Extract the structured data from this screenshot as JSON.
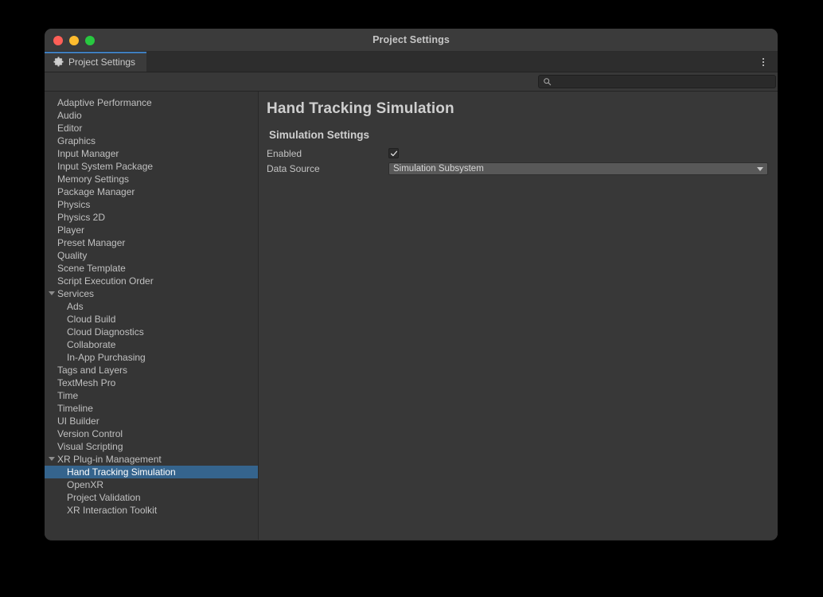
{
  "window": {
    "title": "Project Settings",
    "traffic_lights": [
      {
        "name": "close",
        "color": "#ff5f57"
      },
      {
        "name": "minimize",
        "color": "#febc2e"
      },
      {
        "name": "zoom",
        "color": "#28c840"
      }
    ]
  },
  "tab": {
    "label": "Project Settings",
    "icon": "gear-icon",
    "accent_color": "#3f7fbf",
    "menu_icon": "more-vertical-icon"
  },
  "search": {
    "value": "",
    "placeholder": "",
    "icon": "search-icon"
  },
  "sidebar": {
    "items": [
      {
        "label": "Adaptive Performance",
        "depth": 0,
        "expandable": false,
        "selected": false
      },
      {
        "label": "Audio",
        "depth": 0,
        "expandable": false,
        "selected": false
      },
      {
        "label": "Editor",
        "depth": 0,
        "expandable": false,
        "selected": false
      },
      {
        "label": "Graphics",
        "depth": 0,
        "expandable": false,
        "selected": false
      },
      {
        "label": "Input Manager",
        "depth": 0,
        "expandable": false,
        "selected": false
      },
      {
        "label": "Input System Package",
        "depth": 0,
        "expandable": false,
        "selected": false
      },
      {
        "label": "Memory Settings",
        "depth": 0,
        "expandable": false,
        "selected": false
      },
      {
        "label": "Package Manager",
        "depth": 0,
        "expandable": false,
        "selected": false
      },
      {
        "label": "Physics",
        "depth": 0,
        "expandable": false,
        "selected": false
      },
      {
        "label": "Physics 2D",
        "depth": 0,
        "expandable": false,
        "selected": false
      },
      {
        "label": "Player",
        "depth": 0,
        "expandable": false,
        "selected": false
      },
      {
        "label": "Preset Manager",
        "depth": 0,
        "expandable": false,
        "selected": false
      },
      {
        "label": "Quality",
        "depth": 0,
        "expandable": false,
        "selected": false
      },
      {
        "label": "Scene Template",
        "depth": 0,
        "expandable": false,
        "selected": false
      },
      {
        "label": "Script Execution Order",
        "depth": 0,
        "expandable": false,
        "selected": false
      },
      {
        "label": "Services",
        "depth": 0,
        "expandable": true,
        "selected": false
      },
      {
        "label": "Ads",
        "depth": 1,
        "expandable": false,
        "selected": false
      },
      {
        "label": "Cloud Build",
        "depth": 1,
        "expandable": false,
        "selected": false
      },
      {
        "label": "Cloud Diagnostics",
        "depth": 1,
        "expandable": false,
        "selected": false
      },
      {
        "label": "Collaborate",
        "depth": 1,
        "expandable": false,
        "selected": false
      },
      {
        "label": "In-App Purchasing",
        "depth": 1,
        "expandable": false,
        "selected": false
      },
      {
        "label": "Tags and Layers",
        "depth": 0,
        "expandable": false,
        "selected": false
      },
      {
        "label": "TextMesh Pro",
        "depth": 0,
        "expandable": false,
        "selected": false
      },
      {
        "label": "Time",
        "depth": 0,
        "expandable": false,
        "selected": false
      },
      {
        "label": "Timeline",
        "depth": 0,
        "expandable": false,
        "selected": false
      },
      {
        "label": "UI Builder",
        "depth": 0,
        "expandable": false,
        "selected": false
      },
      {
        "label": "Version Control",
        "depth": 0,
        "expandable": false,
        "selected": false
      },
      {
        "label": "Visual Scripting",
        "depth": 0,
        "expandable": false,
        "selected": false
      },
      {
        "label": "XR Plug-in Management",
        "depth": 0,
        "expandable": true,
        "selected": false
      },
      {
        "label": "Hand Tracking Simulation",
        "depth": 1,
        "expandable": false,
        "selected": true
      },
      {
        "label": "OpenXR",
        "depth": 1,
        "expandable": false,
        "selected": false
      },
      {
        "label": "Project Validation",
        "depth": 1,
        "expandable": false,
        "selected": false
      },
      {
        "label": "XR Interaction Toolkit",
        "depth": 1,
        "expandable": false,
        "selected": false
      }
    ],
    "selection_color": "#35648d"
  },
  "content": {
    "title": "Hand Tracking Simulation",
    "section": {
      "title": "Simulation Settings",
      "rows": [
        {
          "label": "Enabled",
          "type": "checkbox",
          "checked": true
        },
        {
          "label": "Data Source",
          "type": "dropdown",
          "value": "Simulation Subsystem"
        }
      ]
    }
  }
}
